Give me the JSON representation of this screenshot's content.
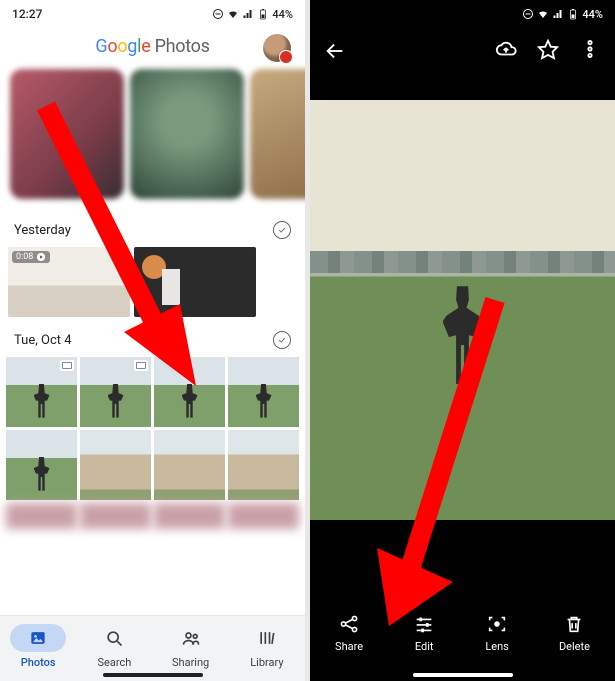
{
  "status": {
    "time": "12:27",
    "battery": "44%"
  },
  "left": {
    "logo_word1_letters": [
      "G",
      "o",
      "o",
      "g",
      "l",
      "e"
    ],
    "logo_word2": " Photos",
    "sections": {
      "yesterday": {
        "label": "Yesterday",
        "video_duration": "0:08"
      },
      "tue": {
        "label": "Tue, Oct 4"
      }
    },
    "nav": {
      "photos": "Photos",
      "search": "Search",
      "sharing": "Sharing",
      "library": "Library"
    }
  },
  "right": {
    "actions": {
      "share": "Share",
      "edit": "Edit",
      "lens": "Lens",
      "delete": "Delete"
    }
  }
}
